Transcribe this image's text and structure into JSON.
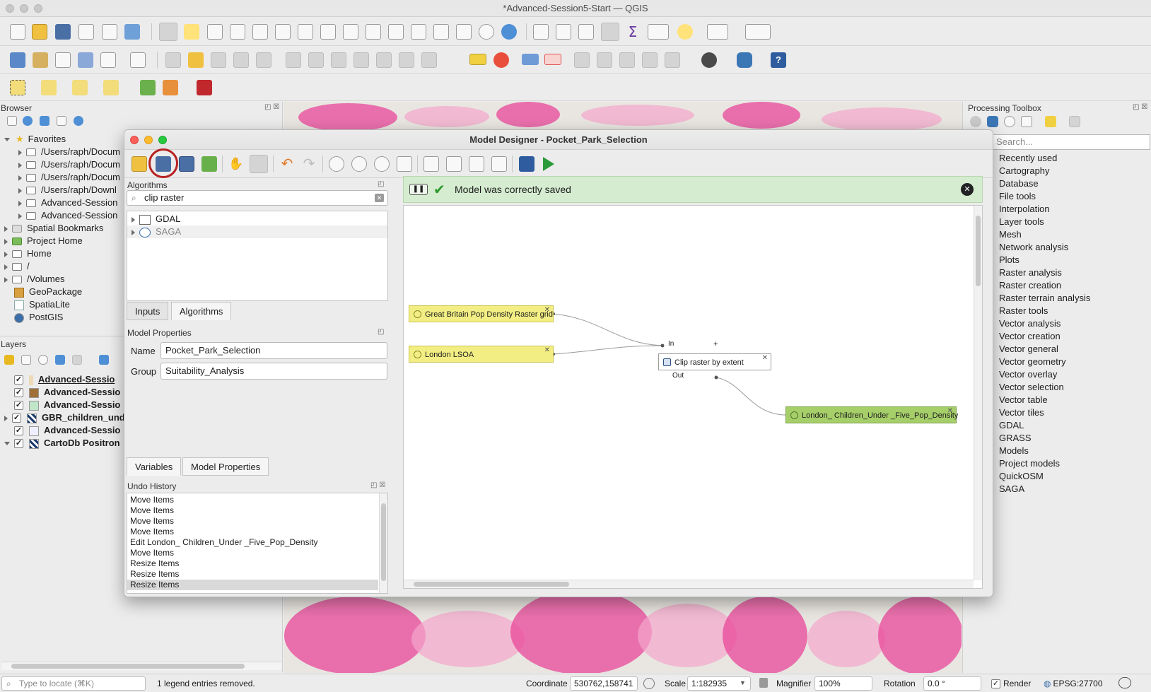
{
  "window": {
    "title": "*Advanced-Session5-Start — QGIS"
  },
  "colors": {
    "accent": "#4aa833",
    "highlight_ring": "#b72222",
    "saved_bar": "#d5ecd0",
    "input_node": "#f2ee84",
    "output_node": "#a6cf6a",
    "map_pink": "#e8479a"
  },
  "browser": {
    "title": "Browser",
    "items": [
      {
        "label": "Favorites",
        "icon": "star-icon"
      },
      {
        "label": "/Users/raph/Docum"
      },
      {
        "label": "/Users/raph/Docum"
      },
      {
        "label": "/Users/raph/Docum"
      },
      {
        "label": "/Users/raph/Downl"
      },
      {
        "label": "Advanced-Session"
      },
      {
        "label": "Advanced-Session"
      },
      {
        "label": "Spatial Bookmarks"
      },
      {
        "label": "Project Home"
      },
      {
        "label": "Home"
      },
      {
        "label": "/"
      },
      {
        "label": "/Volumes"
      },
      {
        "label": "GeoPackage"
      },
      {
        "label": "SpatiaLite"
      },
      {
        "label": "PostGIS"
      }
    ]
  },
  "layers": {
    "title": "Layers",
    "items": [
      {
        "label": "Advanced-Sessio",
        "checked": true,
        "underline": true
      },
      {
        "label": "Advanced-Sessio",
        "checked": true
      },
      {
        "label": "Advanced-Sessio",
        "checked": true
      },
      {
        "label": "GBR_children_und",
        "checked": true
      },
      {
        "label": "Advanced-Sessio",
        "checked": true
      },
      {
        "label": "CartoDb Positron",
        "checked": true
      }
    ]
  },
  "toolbox": {
    "title": "Processing Toolbox",
    "search_placeholder": "Search...",
    "items": [
      "Recently used",
      "Cartography",
      "Database",
      "File tools",
      "Interpolation",
      "Layer tools",
      "Mesh",
      "Network analysis",
      "Plots",
      "Raster analysis",
      "Raster creation",
      "Raster terrain analysis",
      "Raster tools",
      "Vector analysis",
      "Vector creation",
      "Vector general",
      "Vector geometry",
      "Vector overlay",
      "Vector selection",
      "Vector table",
      "Vector tiles",
      "GDAL",
      "GRASS",
      "Models",
      "Project models",
      "QuickOSM",
      "SAGA"
    ]
  },
  "dialog": {
    "title": "Model Designer - Pocket_Park_Selection",
    "algorithms_panel": {
      "title": "Algorithms",
      "search_value": "clip raster",
      "providers": [
        {
          "label": "GDAL"
        },
        {
          "label": "SAGA"
        }
      ]
    },
    "tabs_top": [
      "Inputs",
      "Algorithms"
    ],
    "model_properties": {
      "title": "Model Properties",
      "name_label": "Name",
      "name_value": "Pocket_Park_Selection",
      "group_label": "Group",
      "group_value": "Suitability_Analysis"
    },
    "tabs_bottom": [
      "Variables",
      "Model Properties"
    ],
    "undo_history": {
      "title": "Undo History",
      "items": [
        "Move Items",
        "Move Items",
        "Move Items",
        "Move Items",
        "Edit London_ Children_Under _Five_Pop_Density",
        "Move Items",
        "Resize Items",
        "Resize Items",
        "Resize Items"
      ]
    },
    "message": "Model was correctly saved",
    "graph": {
      "input1": "Great Britain Pop Density Raster grid",
      "input2": "London LSOA",
      "algorithm": "Clip raster by extent",
      "port_in": "In",
      "port_out": "Out",
      "plus": "+",
      "output": "London_ Children_Under _Five_Pop_Density"
    }
  },
  "status": {
    "locate_placeholder": "Type to locate (⌘K)",
    "message": "1 legend entries removed.",
    "coordinate_label": "Coordinate",
    "coordinate_value": "530762,158741",
    "scale_label": "Scale",
    "scale_value": "1:182935",
    "magnifier_label": "Magnifier",
    "magnifier_value": "100%",
    "rotation_label": "Rotation",
    "rotation_value": "0.0 °",
    "render_label": "Render",
    "crs": "EPSG:27700"
  }
}
